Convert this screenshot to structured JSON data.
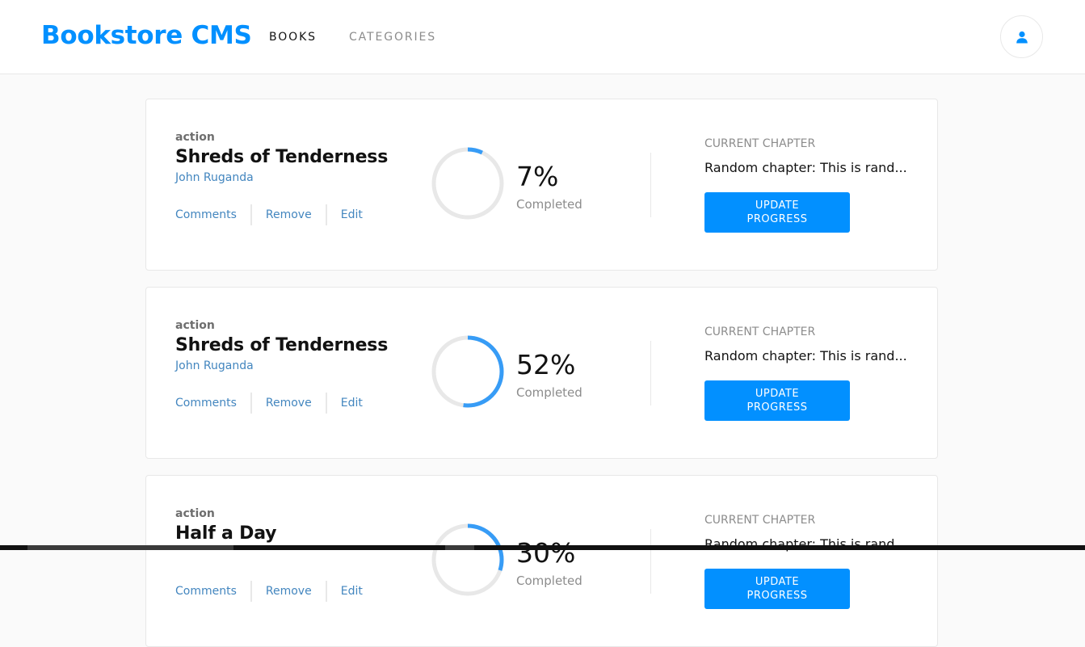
{
  "header": {
    "brand": "Bookstore CMS",
    "nav": [
      {
        "label": "BOOKS",
        "active": true
      },
      {
        "label": "CATEGORIES",
        "active": false
      }
    ],
    "user_icon": "user-icon"
  },
  "books": [
    {
      "genre": "action",
      "title": "Shreds of Tenderness",
      "author": "John Ruganda",
      "actions": {
        "comments": "Comments",
        "remove": "Remove",
        "edit": "Edit"
      },
      "progress": 7,
      "percent_label": "7%",
      "completed_label": "Completed",
      "chapter_label": "CURRENT CHAPTER",
      "chapter_name": "Random chapter: This is rand...",
      "update_label": "UPDATE PROGRESS"
    },
    {
      "genre": "action",
      "title": "Shreds of Tenderness",
      "author": "John Ruganda",
      "actions": {
        "comments": "Comments",
        "remove": "Remove",
        "edit": "Edit"
      },
      "progress": 52,
      "percent_label": "52%",
      "completed_label": "Completed",
      "chapter_label": "CURRENT CHAPTER",
      "chapter_name": "Random chapter: This is rand...",
      "update_label": "UPDATE PROGRESS"
    },
    {
      "genre": "action",
      "title": "Half a Day",
      "author": "",
      "actions": {
        "comments": "Comments",
        "remove": "Remove",
        "edit": "Edit"
      },
      "progress": 30,
      "percent_label": "30%",
      "completed_label": "Completed",
      "chapter_label": "CURRENT CHAPTER",
      "chapter_name": "Random chapter: This is rand...",
      "update_label": "UPDATE PROGRESS"
    }
  ],
  "colors": {
    "brand": "#0290ff",
    "link": "#4386bf",
    "progress": "#379cf6",
    "track": "#e8e8e8"
  }
}
